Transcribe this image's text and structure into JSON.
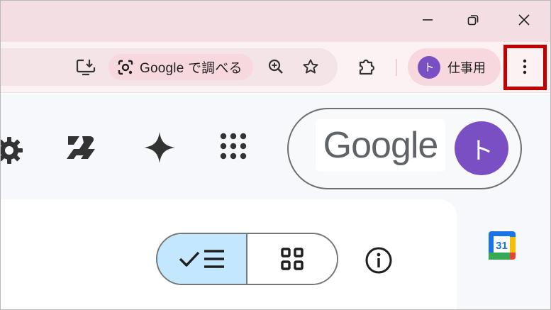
{
  "window": {
    "controls": [
      {
        "icon": "minimize-icon"
      },
      {
        "icon": "restore-icon"
      },
      {
        "icon": "close-icon"
      }
    ]
  },
  "toolbar": {
    "install_icon": "install-app-icon",
    "lens_chip_label": "Google で調べる",
    "lens_icon": "google-lens-icon",
    "zoom_icon": "zoom-in-icon",
    "bookmark_icon": "star-icon",
    "extensions_icon": "puzzle-icon",
    "profile": {
      "initial": "ト",
      "name": "仕事用"
    },
    "menu_icon": "more-vert-icon"
  },
  "page": {
    "header_icons": [
      "settings-icon",
      "gemini-workspace-icon",
      "gemini-sparkle-icon",
      "apps-grid-icon"
    ],
    "account": {
      "logo_text": "Google",
      "avatar_initial": "ト"
    },
    "view_toggle": {
      "list_icon": "checked-list-icon",
      "grid_icon": "grid-view-icon"
    },
    "info_icon": "info-icon",
    "calendar_icon": "google-calendar-icon",
    "calendar_day": "31"
  },
  "colors": {
    "titlebar": "#f3dfe3",
    "toolbar": "#fcf1f3",
    "chip": "#f7d8df",
    "avatar": "#7a4fc4",
    "highlight": "#c00000",
    "toggle_active": "#c2e7ff"
  }
}
